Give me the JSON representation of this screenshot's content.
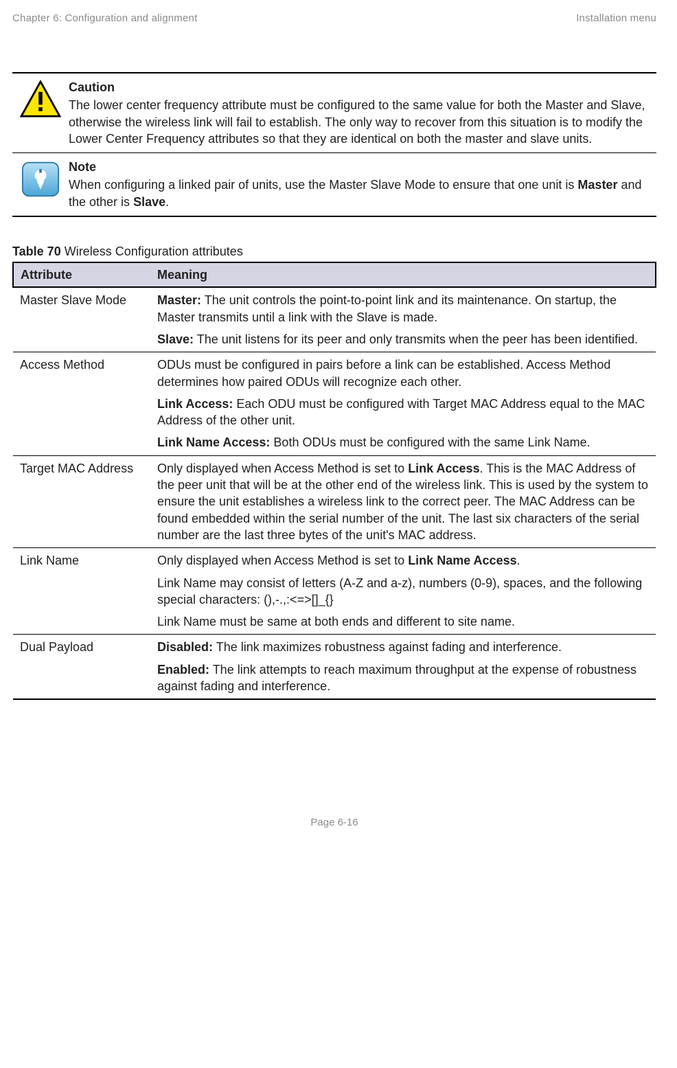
{
  "header": {
    "left": "Chapter 6:  Configuration and alignment",
    "right": "Installation menu"
  },
  "callouts": {
    "caution": {
      "title": "Caution",
      "body": "The lower center frequency attribute must be configured to the same value for both the Master and Slave, otherwise the wireless link will fail to establish. The only way to recover from this situation is to modify the Lower Center Frequency attributes so that they are identical on both the master and slave units."
    },
    "note": {
      "title": "Note",
      "body_pre": "When configuring a linked pair of units, use the Master Slave Mode to ensure that one unit is ",
      "master": "Master",
      "body_mid": " and the other is ",
      "slave": "Slave",
      "body_post": "."
    }
  },
  "table": {
    "caption_label": "Table 70",
    "caption_text": "  Wireless Configuration attributes",
    "head_attr": "Attribute",
    "head_meaning": "Meaning",
    "rows": {
      "r0": {
        "attr": "Master Slave Mode",
        "p0_b": "Master:",
        "p0_t": " The unit controls the point-to-point link and its maintenance. On startup, the Master transmits until a link with the Slave is made.",
        "p1_b": "Slave:",
        "p1_t": " The unit listens for its peer and only transmits when the peer has been identified."
      },
      "r1": {
        "attr": "Access Method",
        "p0": "ODUs must be configured in pairs before a link can be established. Access Method determines how paired ODUs will recognize each other.",
        "p1_b": "Link Access:",
        "p1_t": " Each ODU must be configured with Target MAC Address equal to the MAC Address of the other unit.",
        "p2_b": "Link Name Access:",
        "p2_t": " Both ODUs must be configured with the same Link Name."
      },
      "r2": {
        "attr": "Target MAC Address",
        "p0_pre": "Only displayed when Access Method is set to ",
        "p0_b": "Link Access",
        "p0_post": ". This is the MAC Address of the peer unit that will be at the other end of the wireless link. This is used by the system to ensure the unit establishes a wireless link to the correct peer. The MAC Address can be found embedded within the serial number of the unit. The last six characters of the serial number are the last three bytes of the unit's MAC address."
      },
      "r3": {
        "attr": "Link Name",
        "p0_pre": "Only displayed when Access Method is set to ",
        "p0_b": "Link Name Access",
        "p0_post": ".",
        "p1": "Link Name may consist of letters (A-Z and a-z), numbers (0-9), spaces, and the following special characters: (),-.,:<=>[]_{}",
        "p2": "Link Name must be same at both ends and different to site name."
      },
      "r4": {
        "attr": "Dual Payload",
        "p0_b": "Disabled:",
        "p0_t": " The link maximizes robustness against fading and interference.",
        "p1_b": "Enabled:",
        "p1_t": " The link attempts to reach maximum throughput at the expense of robustness against fading and interference."
      }
    }
  },
  "footer": {
    "page_label": "Page ",
    "page_num": "6-16"
  }
}
